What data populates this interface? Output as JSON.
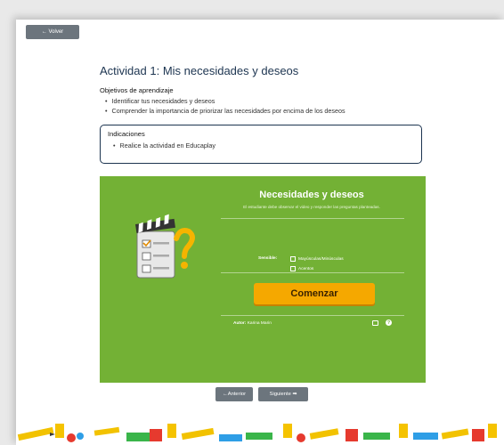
{
  "back_label": "← Volver",
  "title": "Actividad 1: Mis necesidades y deseos",
  "objectives": {
    "heading": "Objetivos de aprendizaje",
    "items": [
      "Identificar tus necesidades y deseos",
      "Comprender la importancia de priorizar las necesidades por encima de los deseos"
    ]
  },
  "instructions": {
    "heading": "Indicaciones",
    "items": [
      "Realice la actividad en Educaplay"
    ]
  },
  "game": {
    "title": "Necesidades y deseos",
    "description": "El estudiante debe observar el video y responder las preguntas planteadas.",
    "sensitivity_label": "Sensible:",
    "options": [
      "Mayúsculas/Minúsculas",
      "Acentos"
    ],
    "start_label": "Comenzar",
    "author_label": "Autor:",
    "author_name": "Karina Marin",
    "background_color": "#73b135",
    "button_color": "#f5a800"
  },
  "nav": {
    "prev_label": "←Anterior",
    "next_label": "Siguiente ➡"
  }
}
